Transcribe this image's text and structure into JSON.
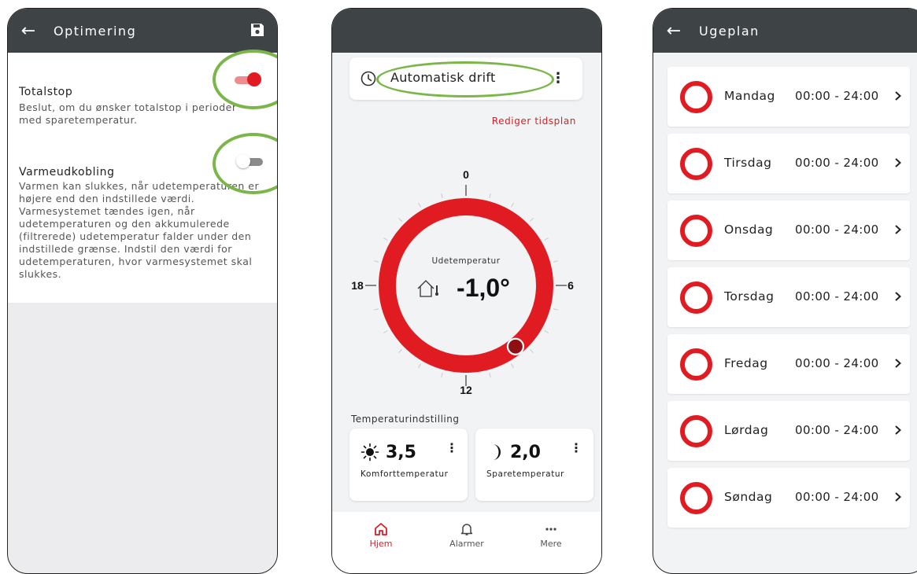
{
  "optimering": {
    "title": "Optimering",
    "back_icon": "arrow-left-icon",
    "save_icon": "floppy-disk-icon",
    "totalstop": {
      "title": "Totalstop",
      "description": "Beslut, om du ønsker totalstop i perioder med sparetemperatur.",
      "enabled": true
    },
    "varmeudkobling": {
      "title": "Varmeudkobling",
      "description": "Varmen kan slukkes, når udetemperaturen er højere end den indstillede værdi. Varmesystemet tændes igen, når udetemperaturen og den akkumulerede (filtrerede) udetemperatur falder under den indstillede grænse. Indstil den værdi for udetemperaturen, hvor varmesystemet skal slukkes.",
      "enabled": false
    }
  },
  "home": {
    "mode_label": "Automatisk drift",
    "edit_schedule": "Rediger tidsplan",
    "dial": {
      "label": "Udetemperatur",
      "value": "-1,0°",
      "ticks": {
        "top": "0",
        "right": "6",
        "bottom": "12",
        "left": "18"
      },
      "current_hour": 9.4
    },
    "temp_section_title": "Temperaturindstilling",
    "comfort": {
      "value": "3,5",
      "label": "Komforttemperatur",
      "icon": "sun-icon"
    },
    "saving": {
      "value": "2,0",
      "label": "Sparetemperatur",
      "icon": "moon-icon"
    },
    "nav": [
      {
        "label": "Hjem",
        "icon": "home-icon",
        "active": true
      },
      {
        "label": "Alarmer",
        "icon": "bell-icon",
        "active": false
      },
      {
        "label": "Mere",
        "icon": "more-horizontal-icon",
        "active": false
      }
    ]
  },
  "ugeplan": {
    "title": "Ugeplan",
    "days": [
      {
        "name": "Mandag",
        "time": "00:00 - 24:00"
      },
      {
        "name": "Tirsdag",
        "time": "00:00 - 24:00"
      },
      {
        "name": "Onsdag",
        "time": "00:00 - 24:00"
      },
      {
        "name": "Torsdag",
        "time": "00:00 - 24:00"
      },
      {
        "name": "Fredag",
        "time": "00:00 - 24:00"
      },
      {
        "name": "Lørdag",
        "time": "00:00 - 24:00"
      },
      {
        "name": "Søndag",
        "time": "00:00 - 24:00"
      }
    ]
  },
  "colors": {
    "brand_red": "#e11b22",
    "header_dark": "#3e4346",
    "highlight_green": "#7ab648",
    "toggle_on_track": "#f08c8c",
    "toggle_off": "#8a8a8a"
  }
}
